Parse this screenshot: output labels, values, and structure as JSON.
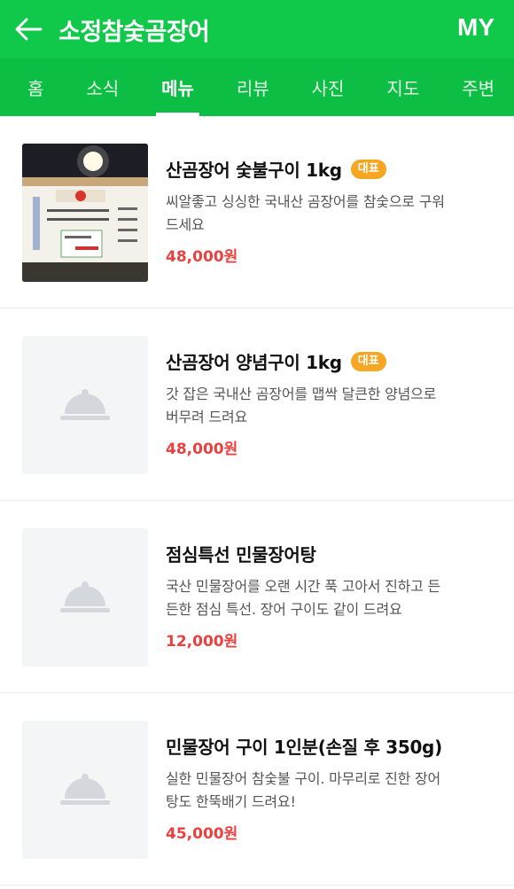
{
  "header": {
    "title": "소정참숯곰장어",
    "my_label": "MY"
  },
  "tabs": [
    {
      "label": "홈"
    },
    {
      "label": "소식"
    },
    {
      "label": "메뉴"
    },
    {
      "label": "리뷰"
    },
    {
      "label": "사진"
    },
    {
      "label": "지도"
    },
    {
      "label": "주변"
    }
  ],
  "menu": [
    {
      "name": "산곰장어 숯불구이 1kg",
      "badge": "대표",
      "desc_line1": "씨알좋고 싱싱한 국내산 곰장어를 참숯으로 구워",
      "desc_line2": "드세요",
      "price": "48,000원",
      "image": "photo"
    },
    {
      "name": "산곰장어 양념구이 1kg",
      "badge": "대표",
      "desc_line1": "갓 잡은 국내산 곰장어를 맵싹 달큰한 양념으로",
      "desc_line2": "버무려 드려요",
      "price": "48,000원",
      "image": "placeholder"
    },
    {
      "name": "점심특선 민물장어탕",
      "badge": "",
      "desc_line1": "국산 민물장어를 오랜 시간 푹 고아서 진하고 든",
      "desc_line2": "든한 점심 특선. 장어 구이도 같이 드려요",
      "price": "12,000원",
      "image": "placeholder"
    },
    {
      "name": "민물장어 구이 1인분(손질 후 350g)",
      "badge": "",
      "desc_line1": "실한 민물장어 참숯불 구이. 마무리로 진한 장어",
      "desc_line2": "탕도 한뚝배기 드려요!",
      "price": "45,000원",
      "image": "placeholder"
    }
  ],
  "colors": {
    "brand_green": "#10c849",
    "price_red": "#e8413f",
    "badge_orange": "#f5a623"
  }
}
